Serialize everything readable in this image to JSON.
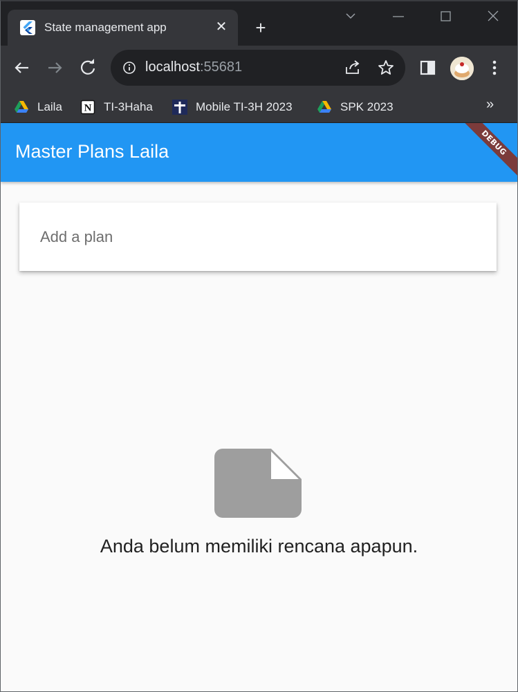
{
  "browser": {
    "tab": {
      "title": "State management app",
      "favicon": "flutter-icon",
      "close_glyph": "✕"
    },
    "new_tab_glyph": "+",
    "address": {
      "host": "localhost",
      "port": ":55681"
    },
    "bookmarks": [
      {
        "label": "Laila",
        "icon": "google-drive-icon"
      },
      {
        "label": "TI-3Haha",
        "icon": "notion-icon"
      },
      {
        "label": "Mobile TI-3H 2023",
        "icon": "cross-flag-icon"
      },
      {
        "label": "SPK 2023",
        "icon": "google-drive-icon"
      }
    ],
    "bookmarks_more_glyph": "»"
  },
  "app": {
    "title": "Master Plans Laila",
    "debug_banner": "DEBUG",
    "primary_color": "#2196f3",
    "input": {
      "placeholder": "Add a plan",
      "value": ""
    },
    "empty_state": {
      "icon": "note-icon",
      "message": "Anda belum memiliki rencana apapun.",
      "icon_color": "#9e9e9e"
    }
  }
}
